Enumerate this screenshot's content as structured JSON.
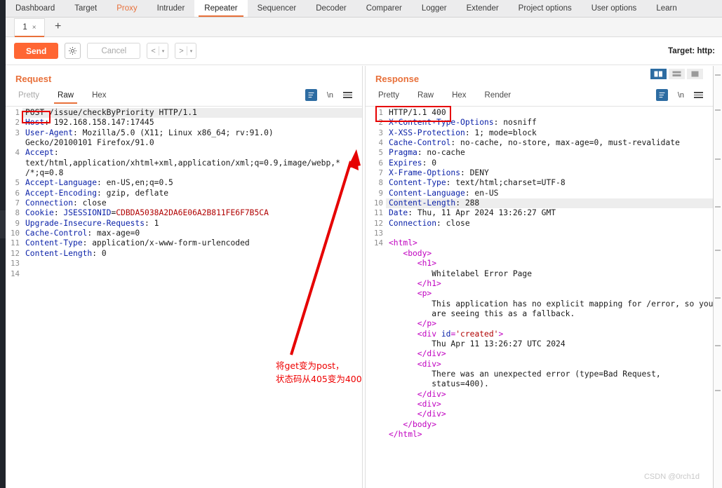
{
  "window": {
    "watermark": "CSDN @0rch1d"
  },
  "main_tabs": [
    {
      "label": "Dashboard",
      "state": "normal"
    },
    {
      "label": "Target",
      "state": "normal"
    },
    {
      "label": "Proxy",
      "state": "highlight"
    },
    {
      "label": "Intruder",
      "state": "normal"
    },
    {
      "label": "Repeater",
      "state": "active"
    },
    {
      "label": "Sequencer",
      "state": "normal"
    },
    {
      "label": "Decoder",
      "state": "normal"
    },
    {
      "label": "Comparer",
      "state": "normal"
    },
    {
      "label": "Logger",
      "state": "normal"
    },
    {
      "label": "Extender",
      "state": "normal"
    },
    {
      "label": "Project options",
      "state": "normal"
    },
    {
      "label": "User options",
      "state": "normal"
    },
    {
      "label": "Learn",
      "state": "normal"
    }
  ],
  "repeater_tabs": {
    "tab_label": "1",
    "close_label": "×",
    "add_label": "+"
  },
  "toolbar": {
    "send_label": "Send",
    "cancel_label": "Cancel",
    "gear_icon": "gear-icon",
    "prev_label": "<",
    "next_label": ">",
    "caret": "▾",
    "target_label": "Target: http:"
  },
  "request": {
    "title": "Request",
    "view_tabs": [
      {
        "label": "Pretty",
        "state": "disabled"
      },
      {
        "label": "Raw",
        "state": "active"
      },
      {
        "label": "Hex",
        "state": "normal"
      }
    ],
    "icons": [
      "word-wrap-icon",
      "show-newlines-icon",
      "menu-icon"
    ],
    "newline_label": "\\n",
    "lines": [
      {
        "n": "1",
        "highlight": true,
        "parts": [
          {
            "t": "POST",
            "c": "hdrv"
          },
          {
            "t": " /issue/checkByPriority HTTP/1.1",
            "c": "hdrv"
          }
        ]
      },
      {
        "n": "2",
        "parts": [
          {
            "t": "Host",
            "c": "hdr"
          },
          {
            "t": ": 192.168.158.147:17445",
            "c": "hdrv"
          }
        ]
      },
      {
        "n": "3",
        "parts": [
          {
            "t": "User-Agent",
            "c": "hdr"
          },
          {
            "t": ": Mozilla/5.0 (X11; Linux x86_64; rv:91.0)",
            "c": "hdrv"
          }
        ]
      },
      {
        "n": "",
        "parts": [
          {
            "t": "Gecko/20100101 Firefox/91.0",
            "c": "hdrv"
          }
        ]
      },
      {
        "n": "4",
        "parts": [
          {
            "t": "Accept",
            "c": "hdr"
          },
          {
            "t": ":",
            "c": "hdrv"
          }
        ]
      },
      {
        "n": "",
        "parts": [
          {
            "t": "text/html,application/xhtml+xml,application/xml;q=0.9,image/webp,*",
            "c": "hdrv"
          }
        ]
      },
      {
        "n": "",
        "parts": [
          {
            "t": "/*;q=0.8",
            "c": "hdrv"
          }
        ]
      },
      {
        "n": "5",
        "parts": [
          {
            "t": "Accept-Language",
            "c": "hdr"
          },
          {
            "t": ": en-US,en;q=0.5",
            "c": "hdrv"
          }
        ]
      },
      {
        "n": "6",
        "parts": [
          {
            "t": "Accept-Encoding",
            "c": "hdr"
          },
          {
            "t": ": gzip, deflate",
            "c": "hdrv"
          }
        ]
      },
      {
        "n": "7",
        "parts": [
          {
            "t": "Connection",
            "c": "hdr"
          },
          {
            "t": ": close",
            "c": "hdrv"
          }
        ]
      },
      {
        "n": "8",
        "parts": [
          {
            "t": "Cookie",
            "c": "hdr"
          },
          {
            "t": ": ",
            "c": "hdrv"
          },
          {
            "t": "JSESSIONID",
            "c": "hdr"
          },
          {
            "t": "=",
            "c": "hdrv"
          },
          {
            "t": "CDBDA5038A2DA6E06A2B811FE6F7B5CA",
            "c": "red"
          }
        ]
      },
      {
        "n": "9",
        "parts": [
          {
            "t": "Upgrade-Insecure-Requests",
            "c": "hdr"
          },
          {
            "t": ": 1",
            "c": "hdrv"
          }
        ]
      },
      {
        "n": "10",
        "parts": [
          {
            "t": "Cache-Control",
            "c": "hdr"
          },
          {
            "t": ": max-age=0",
            "c": "hdrv"
          }
        ]
      },
      {
        "n": "11",
        "parts": [
          {
            "t": "Content-Type",
            "c": "hdr"
          },
          {
            "t": ": application/x-www-form-urlencoded",
            "c": "hdrv"
          }
        ]
      },
      {
        "n": "12",
        "parts": [
          {
            "t": "Content-Length",
            "c": "hdr"
          },
          {
            "t": ": 0",
            "c": "hdrv"
          }
        ]
      },
      {
        "n": "13",
        "parts": [
          {
            "t": "",
            "c": "hdrv"
          }
        ]
      },
      {
        "n": "14",
        "parts": [
          {
            "t": "",
            "c": "hdrv"
          }
        ]
      }
    ]
  },
  "response": {
    "title": "Response",
    "view_tabs": [
      {
        "label": "Pretty",
        "state": "normal"
      },
      {
        "label": "Raw",
        "state": "normal"
      },
      {
        "label": "Hex",
        "state": "normal"
      },
      {
        "label": "Render",
        "state": "normal"
      }
    ],
    "newline_label": "\\n",
    "layout_buttons": [
      "split-vertical-icon",
      "split-horizontal-icon",
      "single-pane-icon"
    ],
    "lines": [
      {
        "n": "1",
        "parts": [
          {
            "t": "HTTP/1.1 400",
            "c": "hdrv"
          }
        ]
      },
      {
        "n": "2",
        "parts": [
          {
            "t": "X-Content-Type-Options",
            "c": "hdr"
          },
          {
            "t": ": nosniff",
            "c": "hdrv"
          }
        ]
      },
      {
        "n": "3",
        "parts": [
          {
            "t": "X-XSS-Protection",
            "c": "hdr"
          },
          {
            "t": ": 1; mode=block",
            "c": "hdrv"
          }
        ]
      },
      {
        "n": "4",
        "parts": [
          {
            "t": "Cache-Control",
            "c": "hdr"
          },
          {
            "t": ": no-cache, no-store, max-age=0, must-revalidate",
            "c": "hdrv"
          }
        ]
      },
      {
        "n": "5",
        "parts": [
          {
            "t": "Pragma",
            "c": "hdr"
          },
          {
            "t": ": no-cache",
            "c": "hdrv"
          }
        ]
      },
      {
        "n": "6",
        "parts": [
          {
            "t": "Expires",
            "c": "hdr"
          },
          {
            "t": ": 0",
            "c": "hdrv"
          }
        ]
      },
      {
        "n": "7",
        "parts": [
          {
            "t": "X-Frame-Options",
            "c": "hdr"
          },
          {
            "t": ": DENY",
            "c": "hdrv"
          }
        ]
      },
      {
        "n": "8",
        "parts": [
          {
            "t": "Content-Type",
            "c": "hdr"
          },
          {
            "t": ": text/html;charset=UTF-8",
            "c": "hdrv"
          }
        ]
      },
      {
        "n": "9",
        "parts": [
          {
            "t": "Content-Language",
            "c": "hdr"
          },
          {
            "t": ": en-US",
            "c": "hdrv"
          }
        ]
      },
      {
        "n": "10",
        "highlight": true,
        "parts": [
          {
            "t": "Content-Length",
            "c": "hdr"
          },
          {
            "t": ": 288",
            "c": "hdrv"
          }
        ]
      },
      {
        "n": "11",
        "parts": [
          {
            "t": "Date",
            "c": "hdr"
          },
          {
            "t": ": Thu, 11 Apr 2024 13:26:27 GMT",
            "c": "hdrv"
          }
        ]
      },
      {
        "n": "12",
        "parts": [
          {
            "t": "Connection",
            "c": "hdr"
          },
          {
            "t": ": close",
            "c": "hdrv"
          }
        ]
      },
      {
        "n": "13",
        "parts": [
          {
            "t": "",
            "c": "hdrv"
          }
        ]
      },
      {
        "n": "14",
        "parts": [
          {
            "t": "<html>",
            "c": "tag"
          }
        ]
      },
      {
        "n": "",
        "parts": [
          {
            "t": "   <body>",
            "c": "tag"
          }
        ]
      },
      {
        "n": "",
        "parts": [
          {
            "t": "      <h1>",
            "c": "tag"
          }
        ]
      },
      {
        "n": "",
        "parts": [
          {
            "t": "         Whitelabel Error Page",
            "c": "hdrv"
          }
        ]
      },
      {
        "n": "",
        "parts": [
          {
            "t": "      </h1>",
            "c": "tag"
          }
        ]
      },
      {
        "n": "",
        "parts": [
          {
            "t": "      <p>",
            "c": "tag"
          }
        ]
      },
      {
        "n": "",
        "parts": [
          {
            "t": "         This application has no explicit mapping for /error, so you",
            "c": "hdrv"
          }
        ]
      },
      {
        "n": "",
        "parts": [
          {
            "t": "         are seeing this as a fallback.",
            "c": "hdrv"
          }
        ]
      },
      {
        "n": "",
        "parts": [
          {
            "t": "      </p>",
            "c": "tag"
          }
        ]
      },
      {
        "n": "",
        "parts": [
          {
            "t": "      <div ",
            "c": "tag"
          },
          {
            "t": "id",
            "c": "attr"
          },
          {
            "t": "=",
            "c": "tag"
          },
          {
            "t": "'created'",
            "c": "val"
          },
          {
            "t": ">",
            "c": "tag"
          }
        ]
      },
      {
        "n": "",
        "parts": [
          {
            "t": "         Thu Apr 11 13:26:27 UTC 2024",
            "c": "hdrv"
          }
        ]
      },
      {
        "n": "",
        "parts": [
          {
            "t": "      </div>",
            "c": "tag"
          }
        ]
      },
      {
        "n": "",
        "parts": [
          {
            "t": "      <div>",
            "c": "tag"
          }
        ]
      },
      {
        "n": "",
        "parts": [
          {
            "t": "         There was an unexpected error (type=Bad Request,",
            "c": "hdrv"
          }
        ]
      },
      {
        "n": "",
        "parts": [
          {
            "t": "         status=400).",
            "c": "hdrv"
          }
        ]
      },
      {
        "n": "",
        "parts": [
          {
            "t": "      </div>",
            "c": "tag"
          }
        ]
      },
      {
        "n": "",
        "parts": [
          {
            "t": "      <div>",
            "c": "tag"
          }
        ]
      },
      {
        "n": "",
        "parts": [
          {
            "t": "      </div>",
            "c": "tag"
          }
        ]
      },
      {
        "n": "",
        "parts": [
          {
            "t": "   </body>",
            "c": "tag"
          }
        ]
      },
      {
        "n": "",
        "parts": [
          {
            "t": "</html>",
            "c": "tag"
          }
        ]
      }
    ]
  },
  "annotation": {
    "line1": "将get变为post，",
    "line2": "状态码从405变为400",
    "color": "#ee0000",
    "arrow": "red-arrow-up-right"
  },
  "highlight_boxes": [
    {
      "name": "request-method-box",
      "color": "#e60000"
    },
    {
      "name": "response-status-box",
      "color": "#e60000"
    }
  ]
}
